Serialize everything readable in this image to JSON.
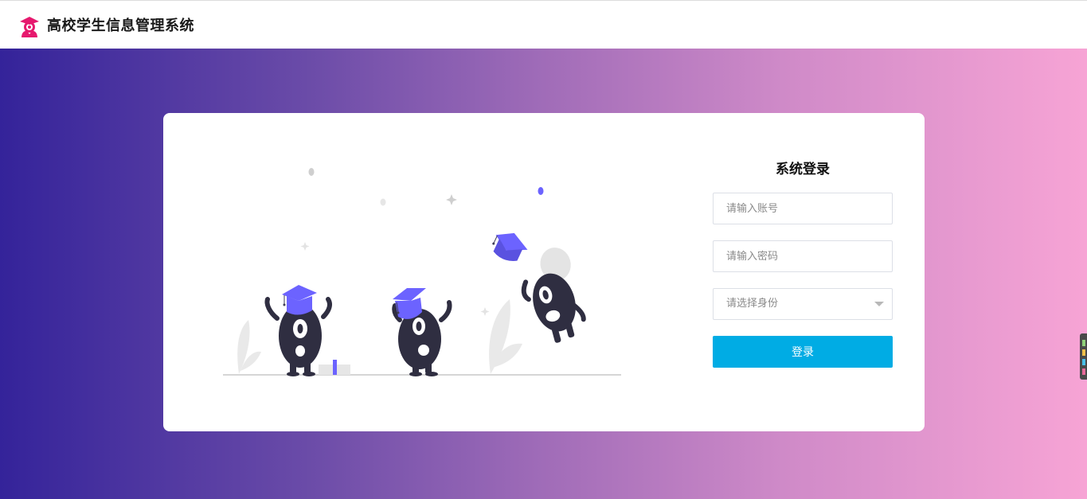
{
  "header": {
    "app_title": "高校学生信息管理系统",
    "logo_icon": "graduate-person-icon",
    "logo_color": "#e6196e"
  },
  "background": {
    "gradient_start": "#34239a",
    "gradient_end": "#f7a4d5"
  },
  "login": {
    "title": "系统登录",
    "account_placeholder": "请输入账号",
    "password_placeholder": "请输入密码",
    "role_select": {
      "placeholder": "请选择身份",
      "icon": "chevron-down-icon"
    },
    "submit_label": "登录",
    "button_color": "#00ace4"
  },
  "illustration": {
    "subject": "graduation-monsters",
    "accent_color": "#6c63ff",
    "body_color": "#2f2e41"
  }
}
